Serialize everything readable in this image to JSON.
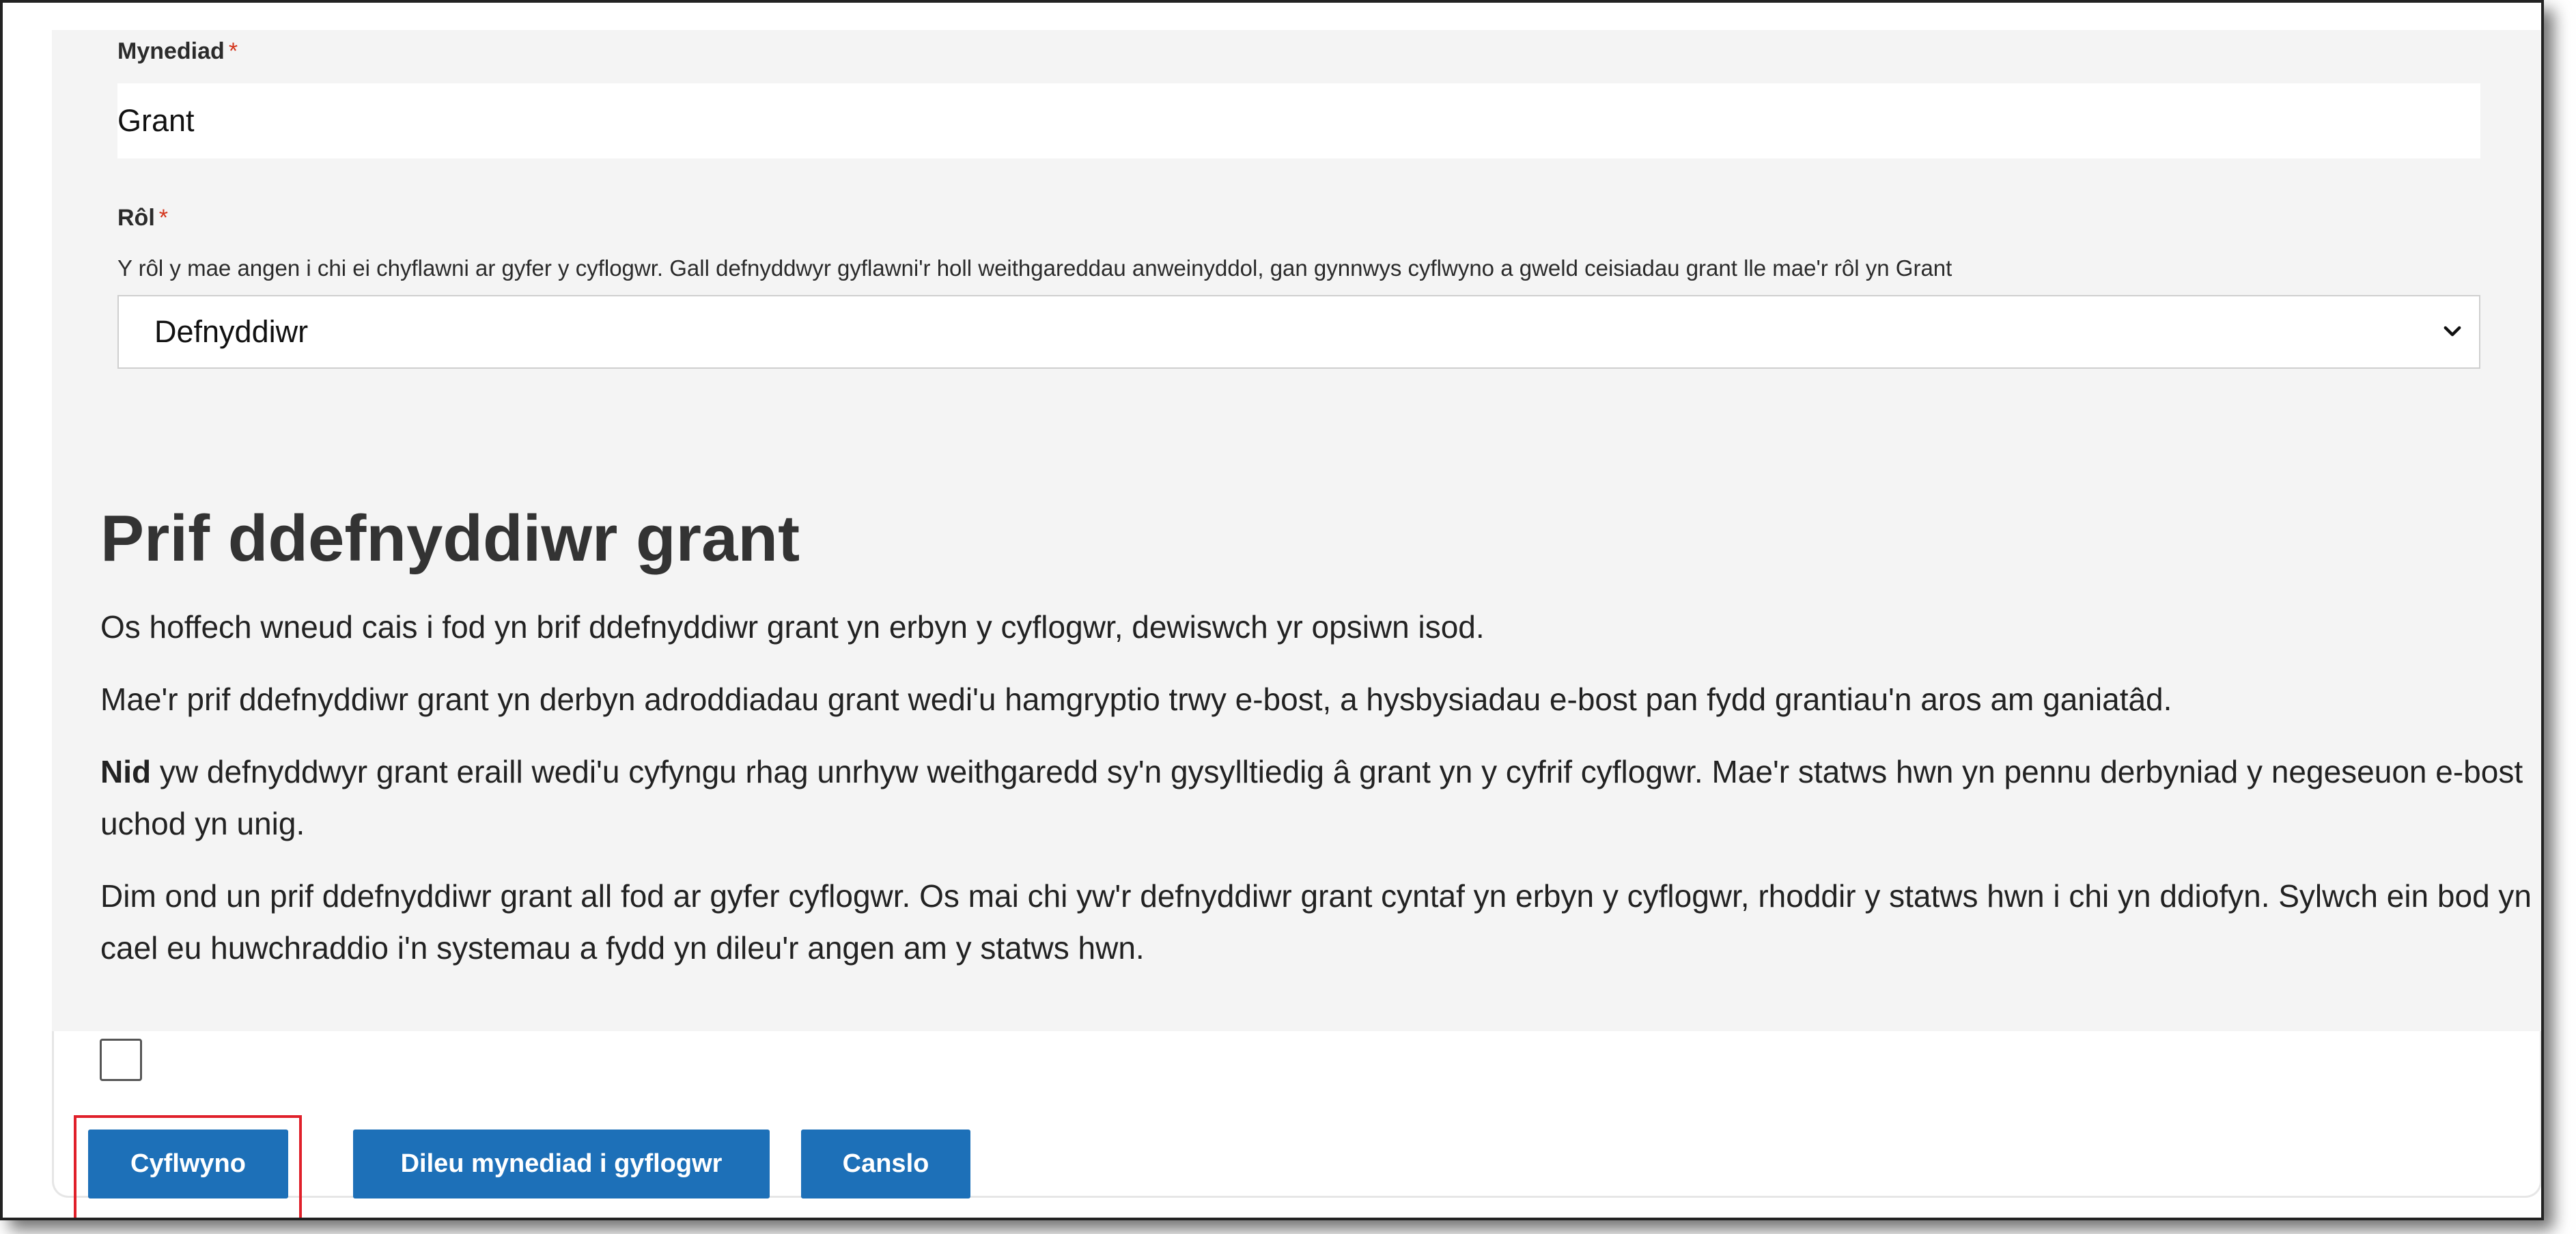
{
  "form": {
    "access_field": {
      "label": "Mynediad",
      "required_marker": "*",
      "value": "Grant"
    },
    "role_field": {
      "label": "Rôl",
      "required_marker": "*",
      "hint": "Y rôl y mae angen i chi ei chyflawni ar gyfer y cyflogwr. Gall defnyddwyr gyflawni'r holl weithgareddau anweinyddol, gan gynnwys cyflwyno a gweld ceisiadau grant lle mae'r rôl yn Grant",
      "selected": "Defnyddiwr"
    }
  },
  "primary_user_section": {
    "heading": "Prif ddefnyddiwr grant",
    "para1": "Os hoffech wneud cais i fod yn brif ddefnyddiwr grant yn erbyn y cyflogwr, dewiswch yr opsiwn isod.",
    "para2": "Mae'r prif ddefnyddiwr grant yn derbyn adroddiadau grant wedi'u hamgryptio trwy e-bost, a hysbysiadau e-bost pan fydd grantiau'n aros am ganiatâd.",
    "para3_bold": "Nid",
    "para3_rest": " yw defnyddwyr grant eraill wedi'u cyfyngu rhag unrhyw weithgaredd sy'n gysylltiedig â grant yn y cyfrif cyflogwr. Mae'r statws hwn yn pennu derbyniad y negeseuon e-bost uchod yn unig.",
    "para4": "Dim ond un prif ddefnyddiwr grant all fod ar gyfer cyflogwr. Os mai chi yw'r defnyddiwr grant cyntaf yn erbyn y cyflogwr, rhoddir y statws hwn i chi yn ddiofyn. Sylwch ein bod yn cael eu huwchraddio i'n systemau a fydd yn dileu'r angen am y statws hwn.",
    "checkbox_checked": false
  },
  "actions": {
    "submit_label": "Cyflwyno",
    "remove_access_label": "Dileu mynediad i gyflogwr",
    "cancel_label": "Canslo"
  },
  "colors": {
    "button_blue": "#1d70b8",
    "required_red": "#d4351c",
    "highlight_red": "#e0202a",
    "panel_grey": "#f4f4f4"
  }
}
